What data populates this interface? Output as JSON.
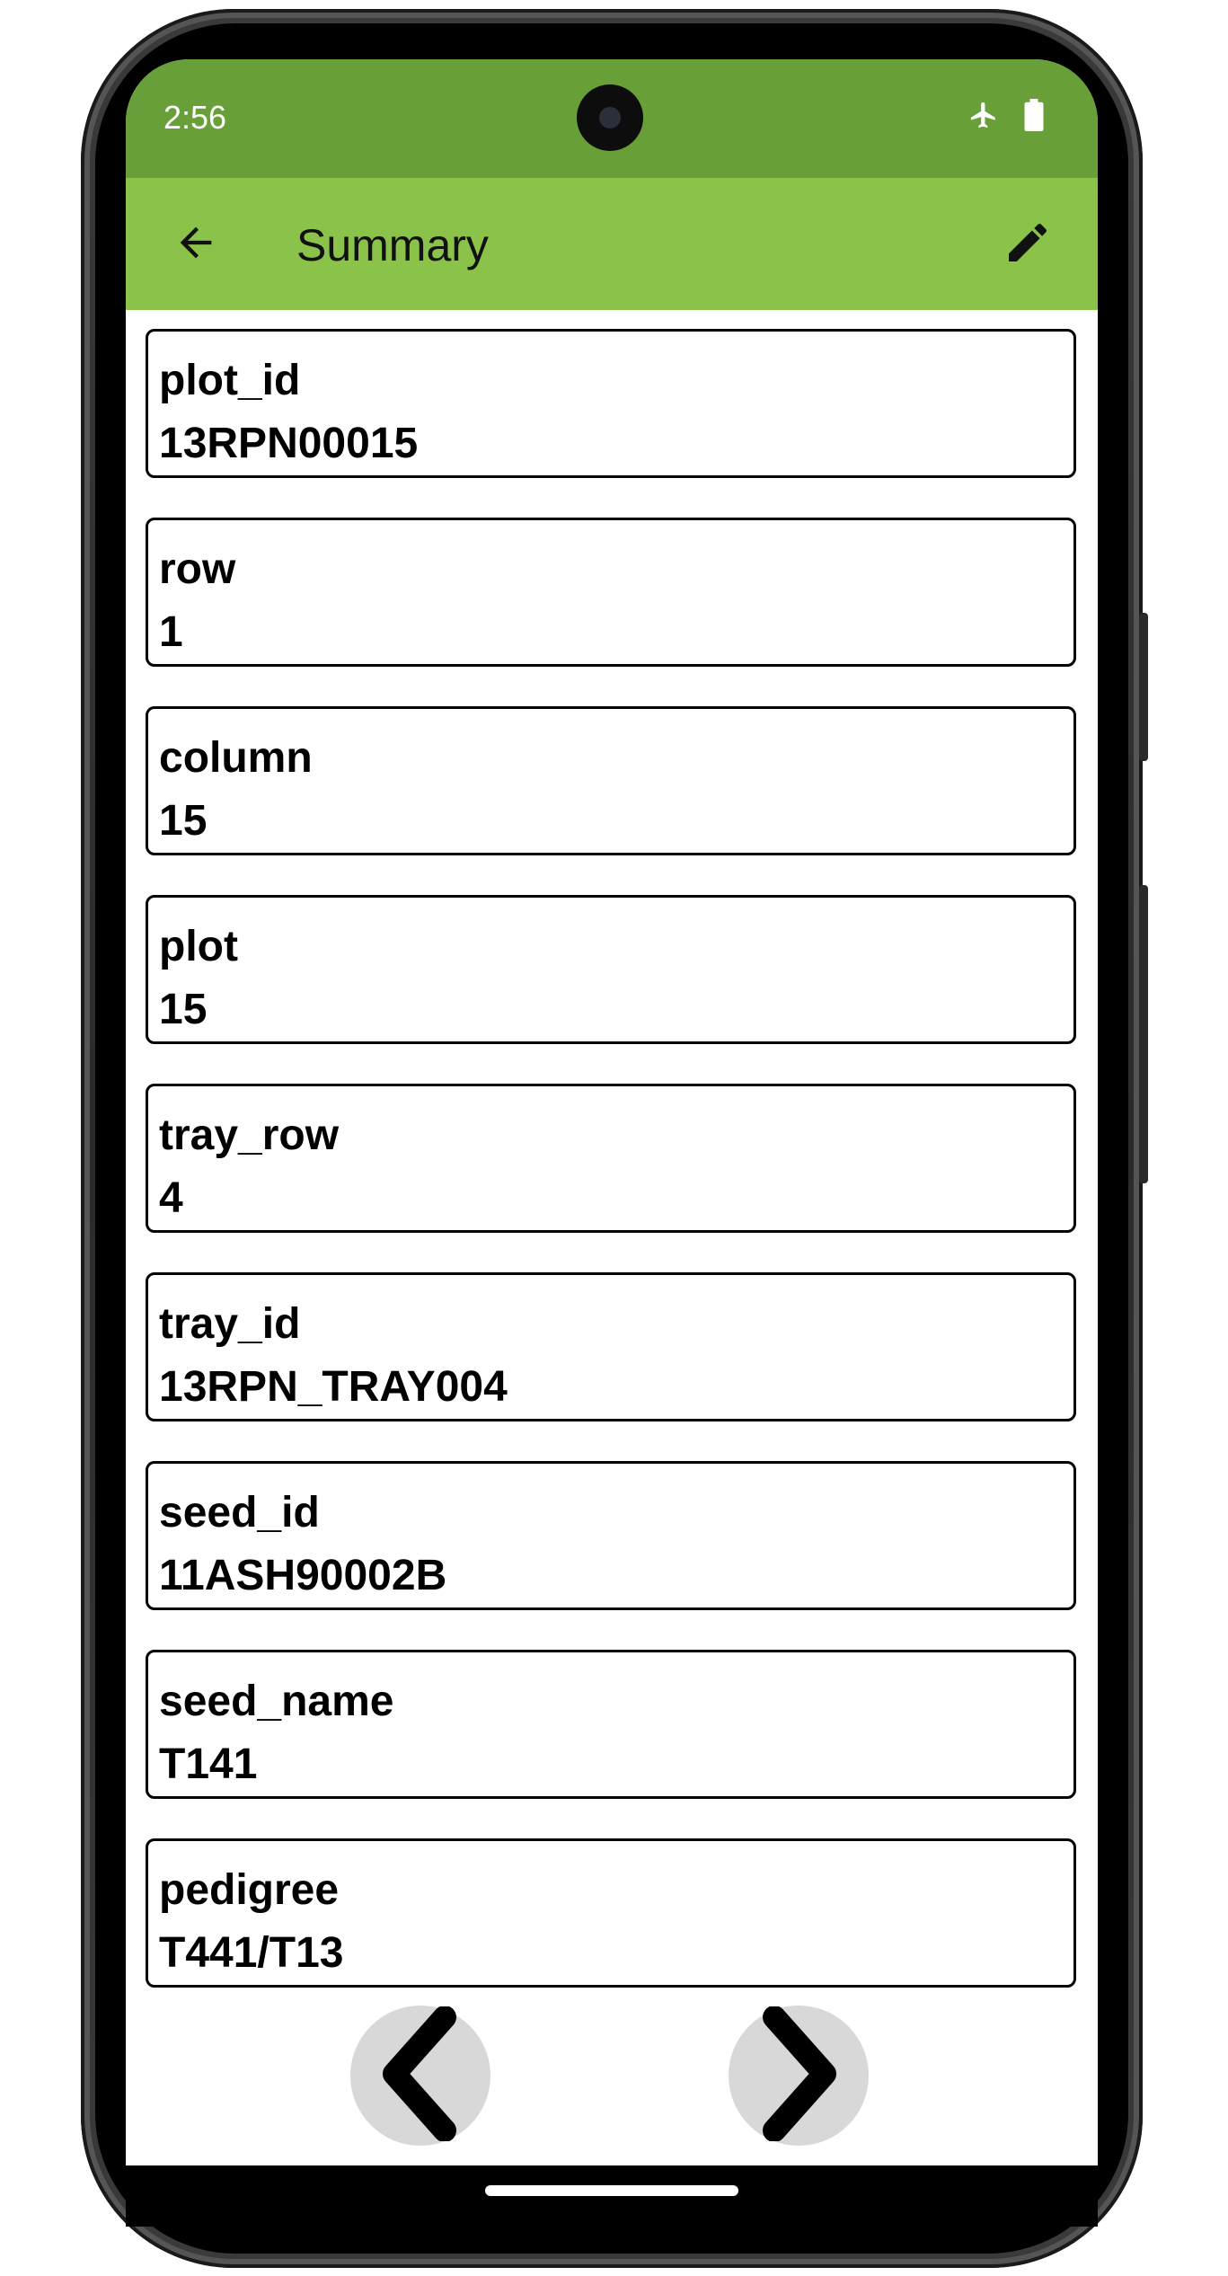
{
  "status_bar": {
    "time": "2:56",
    "icons": [
      "airplane-mode-icon",
      "battery-icon"
    ]
  },
  "app_bar": {
    "title": "Summary",
    "back_icon": "arrow-back-icon",
    "edit_icon": "pencil-icon"
  },
  "fields": [
    {
      "label": "plot_id",
      "value": "13RPN00015"
    },
    {
      "label": "row",
      "value": "1"
    },
    {
      "label": "column",
      "value": "15"
    },
    {
      "label": "plot",
      "value": "15"
    },
    {
      "label": "tray_row",
      "value": "4"
    },
    {
      "label": "tray_id",
      "value": "13RPN_TRAY004"
    },
    {
      "label": "seed_id",
      "value": "11ASH90002B"
    },
    {
      "label": "seed_name",
      "value": "T141"
    },
    {
      "label": "pedigree",
      "value": "T441/T13"
    }
  ],
  "navigation": {
    "prev_icon": "chevron-left-icon",
    "next_icon": "chevron-right-icon"
  },
  "colors": {
    "status_bar": "#689f38",
    "app_bar": "#8bc34a",
    "nav_button": "#d8d8d8"
  }
}
